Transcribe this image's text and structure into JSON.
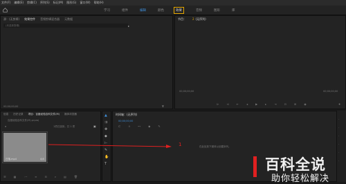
{
  "menu": [
    "文件(F)",
    "编辑(E)",
    "剪辑(C)",
    "序列(S)",
    "标记(M)",
    "图形(G)",
    "窗口(W)",
    "帮助(H)"
  ],
  "workspace_tabs": [
    "学习",
    "组件",
    "编辑",
    "颜色",
    "效果",
    "音频",
    "图形",
    "库"
  ],
  "top_left_tabs": [
    "源：(无剪辑)",
    "效果控件",
    "音频剪辑混合器",
    "元数据"
  ],
  "effect_field": "(未选择剪辑)",
  "program": {
    "title": "节目：",
    "number": "2",
    "seq": "(无序列)"
  },
  "timecode_left": "00;00;00;00",
  "program_tc_left": "00;00;00;00",
  "program_tc_right": "00;00;00;00",
  "project_tabs": [
    "信息",
    "历史记录",
    "项目：百度经验百科文件(M)",
    "媒体浏览器"
  ],
  "project_path": "百度经验百科文件(M).prproj",
  "selection_info": "1项已选择，共 1 项",
  "clip_name": "日落.mp4",
  "clip_duration": "4;8",
  "timeline": {
    "title": "时间轴：(无序列)",
    "tc": "00;00;00;00",
    "drop_text": "在此处放下媒体以创建序列。"
  },
  "annotation_number": "1",
  "watermark": {
    "line1": "百科全说",
    "line2": "助你轻松解决"
  },
  "colors": {
    "accent": "#3f8ed8",
    "highlight": "#e6a700",
    "arrow": "#e02020"
  }
}
